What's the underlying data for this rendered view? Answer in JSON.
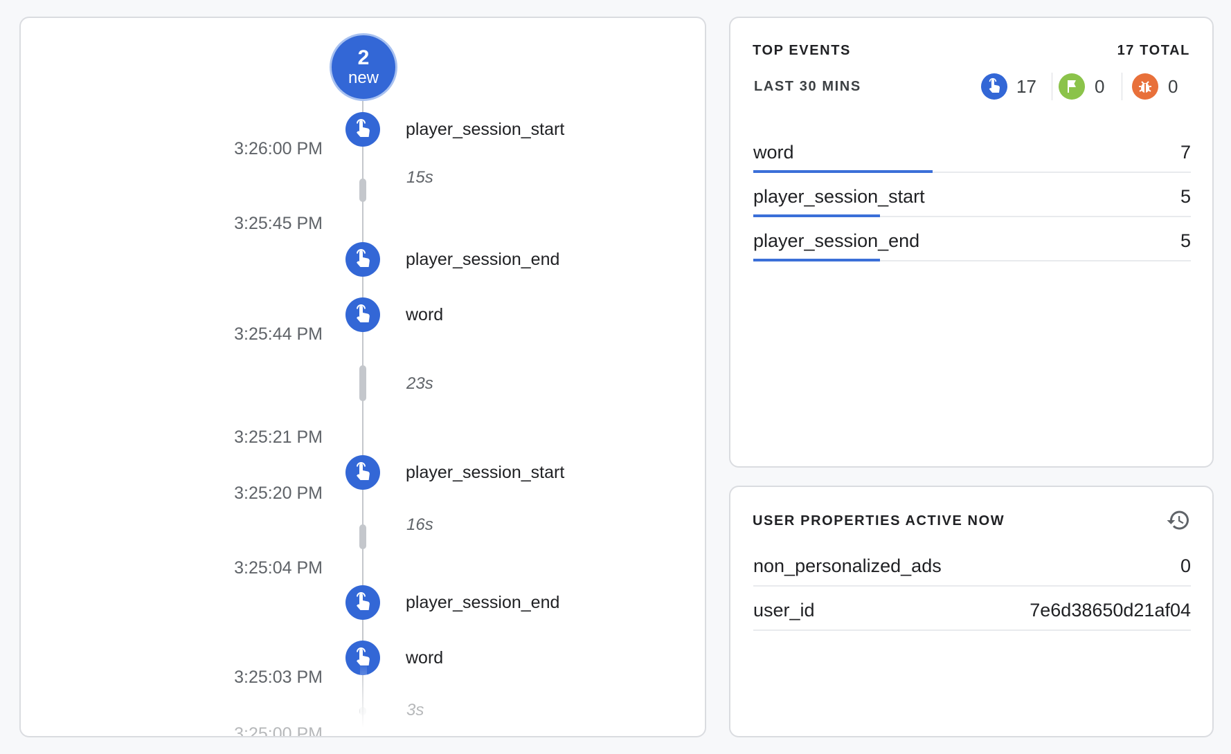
{
  "timeline": {
    "new_count": "2",
    "new_label": "new",
    "events": [
      {
        "name": "player_session_start",
        "icon": "touch-icon"
      },
      {
        "name": "player_session_end",
        "icon": "touch-icon"
      },
      {
        "name": "word",
        "icon": "touch-icon"
      },
      {
        "name": "player_session_start",
        "icon": "touch-icon"
      },
      {
        "name": "player_session_end",
        "icon": "touch-icon"
      },
      {
        "name": "word",
        "icon": "touch-icon"
      }
    ],
    "timestamps": [
      "3:26:00 PM",
      "3:25:45 PM",
      "3:25:44 PM",
      "3:25:21 PM",
      "3:25:20 PM",
      "3:25:04 PM",
      "3:25:03 PM",
      "3:25:00 PM"
    ],
    "gaps": [
      "15s",
      "23s",
      "16s",
      "3s"
    ]
  },
  "top_events": {
    "title": "TOP EVENTS",
    "total": "17 TOTAL",
    "range": "LAST 30 MINS",
    "stats": [
      {
        "icon": "touch-icon",
        "count": "17",
        "color": "#3367d6"
      },
      {
        "icon": "flag-icon",
        "count": "0",
        "color": "#8bc34a"
      },
      {
        "icon": "bug-icon",
        "count": "0",
        "color": "#e8703a"
      }
    ],
    "rows": [
      {
        "name": "word",
        "value": "7",
        "share": 0.41
      },
      {
        "name": "player_session_start",
        "value": "5",
        "share": 0.29
      },
      {
        "name": "player_session_end",
        "value": "5",
        "share": 0.29
      }
    ]
  },
  "user_properties": {
    "title": "USER PROPERTIES ACTIVE NOW",
    "icon": "history-icon",
    "rows": [
      {
        "name": "non_personalized_ads",
        "value": "0"
      },
      {
        "name": "user_id",
        "value": "7e6d38650d21af04"
      }
    ]
  }
}
